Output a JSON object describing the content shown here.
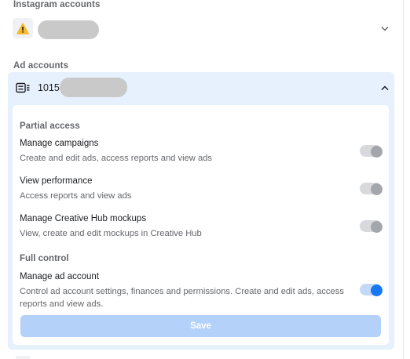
{
  "instagram": {
    "heading": "Instagram accounts",
    "warning_icon": "warning-triangle-icon",
    "chevron_icon": "chevron-down-icon"
  },
  "ad_accounts": {
    "heading": "Ad accounts",
    "account_id_visible": "1015",
    "account_icon": "ad-account-icon",
    "chevron_icon": "chevron-up-icon"
  },
  "permissions": {
    "partial_heading": "Partial access",
    "full_heading": "Full control",
    "items": [
      {
        "title": "Manage campaigns",
        "description": "Create and edit ads, access reports and view ads",
        "enabled": false
      },
      {
        "title": "View performance",
        "description": "Access reports and view ads",
        "enabled": false
      },
      {
        "title": "Manage Creative Hub mockups",
        "description": "View, create and edit mockups in Creative Hub",
        "enabled": false
      },
      {
        "title": "Manage ad account",
        "description": "Control ad account settings, finances and permissions. Create and edit ads, access reports and view ads.",
        "enabled": true
      }
    ],
    "save_label": "Save"
  },
  "colors": {
    "accent": "#1877f2",
    "card_bg": "#e7f0fd",
    "save_disabled": "#b3d1f9",
    "toggle_off": "#a3a6aa"
  }
}
